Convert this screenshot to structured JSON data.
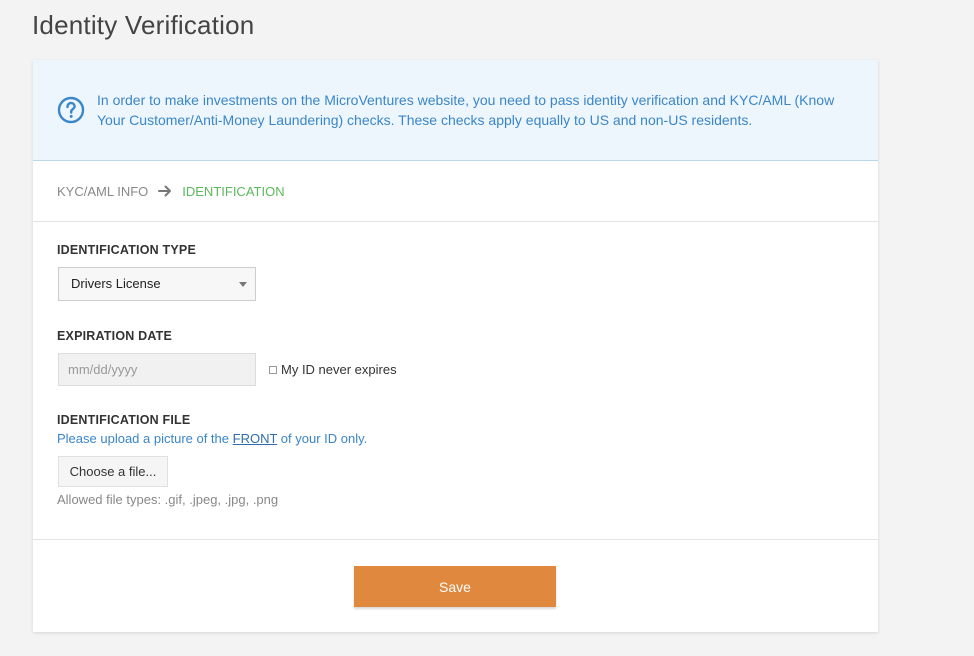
{
  "page": {
    "title": "Identity Verification"
  },
  "banner": {
    "icon": "question-circle-icon",
    "text": "In order to make investments on the MicroVentures website, you need to pass identity verification and KYC/AML (Know Your Customer/Anti-Money Laundering) checks. These checks apply equally to US and non-US residents."
  },
  "breadcrumb": {
    "step1": "KYC/AML INFO",
    "arrow_icon": "arrow-right-icon",
    "step2": "IDENTIFICATION"
  },
  "form": {
    "id_type": {
      "label": "IDENTIFICATION TYPE",
      "selected": "Drivers License"
    },
    "expiration": {
      "label": "EXPIRATION DATE",
      "placeholder": "mm/dd/yyyy",
      "value": "",
      "checkbox_label": "My ID never expires",
      "checkbox_checked": false
    },
    "file": {
      "label": "IDENTIFICATION FILE",
      "hint_prefix": "Please upload a picture of the ",
      "hint_emphasis": "FRONT",
      "hint_suffix": " of your ID only.",
      "button_label": "Choose a file...",
      "allowed": "Allowed file types: .gif, .jpeg, .jpg, .png"
    }
  },
  "footer": {
    "save_label": "Save"
  },
  "colors": {
    "accent_orange": "#e0893e",
    "info_blue": "#3a86c8",
    "success_green": "#5cb85c",
    "banner_bg": "#eef6fd"
  }
}
